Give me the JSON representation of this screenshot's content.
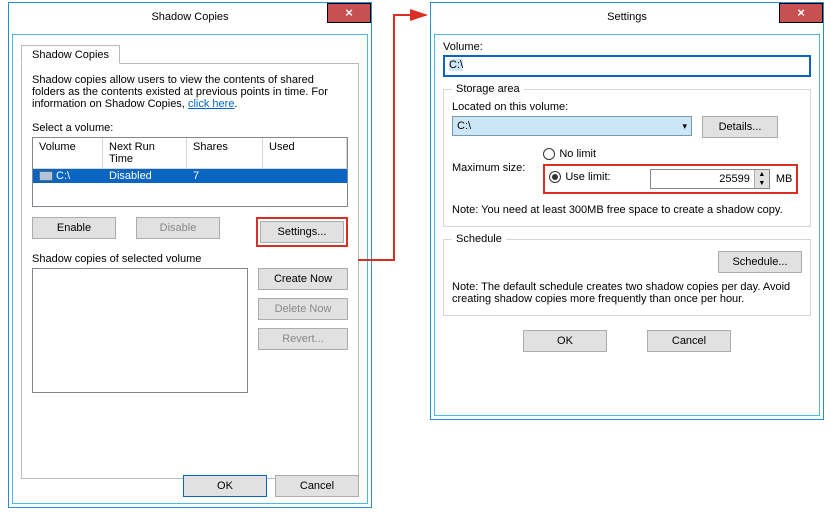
{
  "left": {
    "title": "Shadow Copies",
    "tab": "Shadow Copies",
    "intro_a": "Shadow copies allow users to view the contents of shared folders as the contents existed at previous points in time. For information on Shadow Copies, ",
    "intro_link": "click here",
    "select_volume": "Select a volume:",
    "headers": {
      "volume": "Volume",
      "next": "Next Run Time",
      "shares": "Shares",
      "used": "Used"
    },
    "row": {
      "volume": "C:\\",
      "next": "Disabled",
      "shares": "7",
      "used": ""
    },
    "buttons": {
      "enable": "Enable",
      "disable": "Disable",
      "settings": "Settings..."
    },
    "selvol_label": "Shadow copies of selected volume",
    "rbuttons": {
      "create": "Create Now",
      "delete": "Delete Now",
      "revert": "Revert..."
    },
    "ok": "OK",
    "cancel": "Cancel"
  },
  "right": {
    "title": "Settings",
    "volume_label": "Volume:",
    "volume_value": "C:\\",
    "storage": {
      "legend": "Storage area",
      "located": "Located on this volume:",
      "located_value": "C:\\",
      "details": "Details..."
    },
    "maxsize": {
      "label": "Maximum size:",
      "nolimit": "No limit",
      "uselimit": "Use limit:",
      "value": "25599",
      "unit": "MB",
      "note": "Note: You need at least 300MB free space to create a shadow copy."
    },
    "schedule": {
      "legend": "Schedule",
      "button": "Schedule...",
      "note": "Note: The default schedule creates two shadow copies per day. Avoid creating shadow copies more frequently than once per hour."
    },
    "ok": "OK",
    "cancel": "Cancel"
  }
}
